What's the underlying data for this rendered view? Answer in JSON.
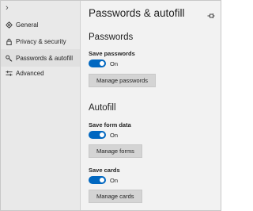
{
  "sidebar": {
    "items": [
      {
        "label": "General",
        "icon": "gear-icon"
      },
      {
        "label": "Privacy & security",
        "icon": "lock-icon"
      },
      {
        "label": "Passwords & autofill",
        "icon": "key-icon",
        "selected": true
      },
      {
        "label": "Advanced",
        "icon": "sliders-icon"
      }
    ]
  },
  "main": {
    "title": "Passwords & autofill",
    "sections": [
      {
        "title": "Passwords",
        "setting_label": "Save passwords",
        "toggle_state": "On",
        "button_label": "Manage passwords"
      },
      {
        "title": "Autofill",
        "setting_label": "Save form data",
        "toggle_state": "On",
        "button_label": "Manage forms"
      },
      {
        "setting_label": "Save cards",
        "toggle_state": "On",
        "button_label": "Manage cards"
      }
    ]
  },
  "colors": {
    "accent": "#0067c0",
    "sidebar_bg": "#e9e9e9",
    "content_bg": "#f2f2f2",
    "button_bg": "#d4d4d4"
  }
}
